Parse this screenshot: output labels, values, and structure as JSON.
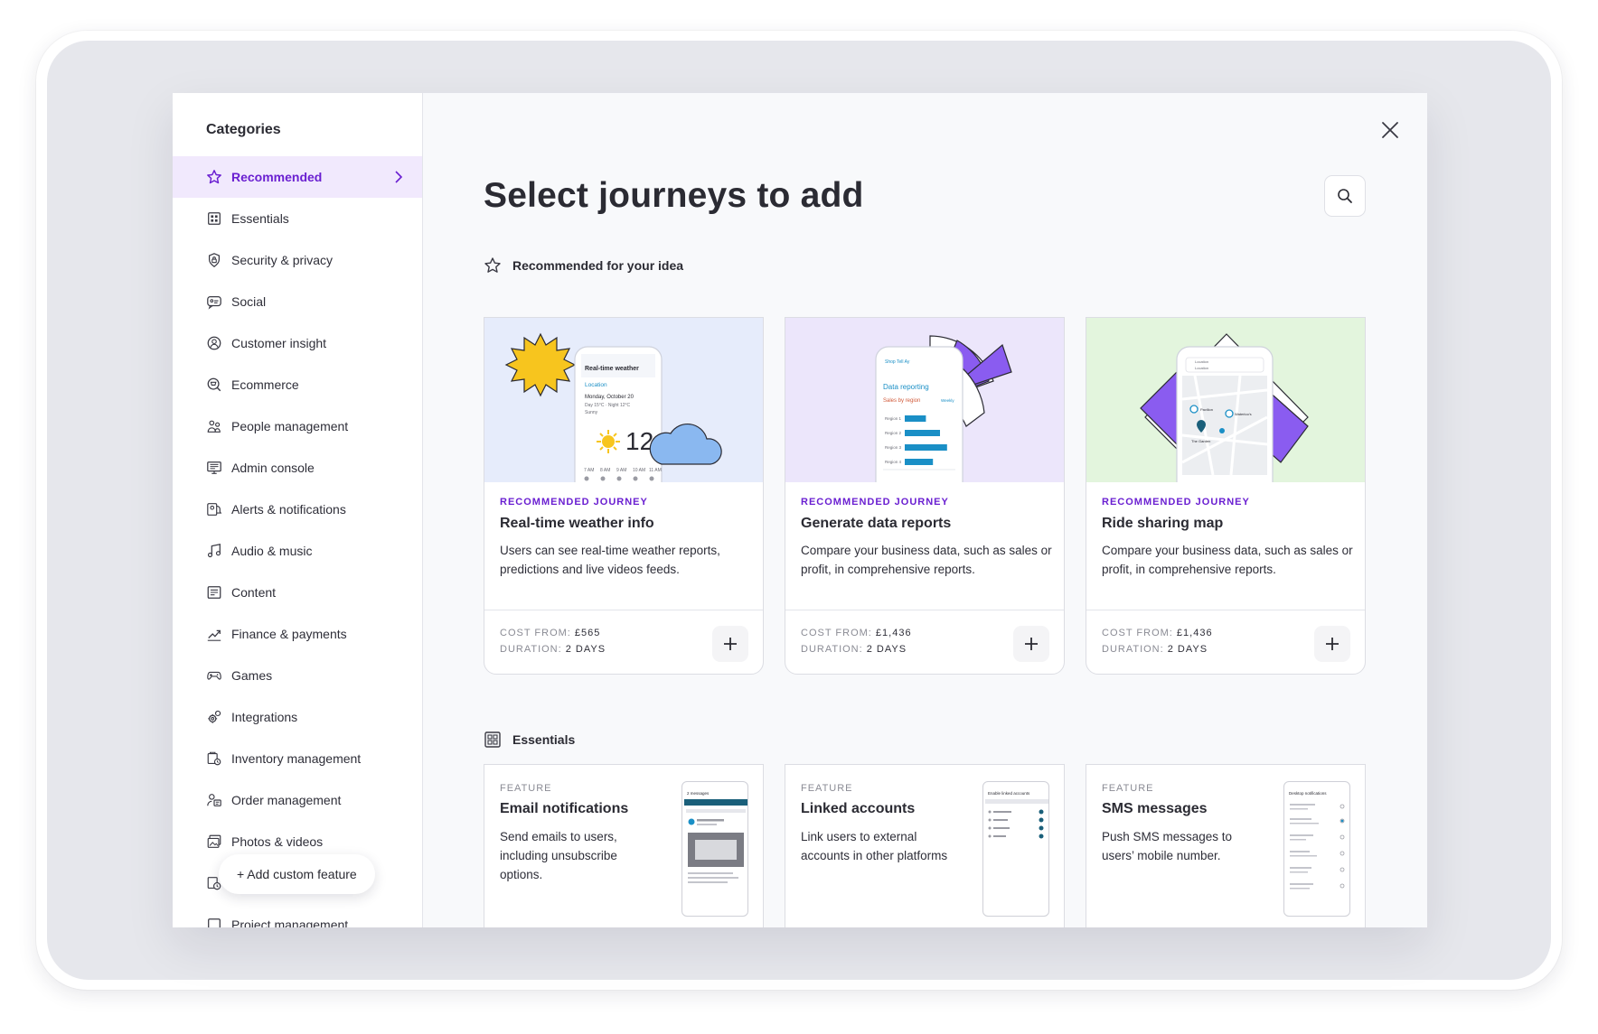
{
  "sidebar": {
    "title": "Categories",
    "items": [
      {
        "label": "Recommended",
        "icon": "star-icon"
      },
      {
        "label": "Essentials",
        "icon": "grid-icon"
      },
      {
        "label": "Security & privacy",
        "icon": "shield-icon"
      },
      {
        "label": "Social",
        "icon": "chat-icon"
      },
      {
        "label": "Customer insight",
        "icon": "insight-icon"
      },
      {
        "label": "Ecommerce",
        "icon": "cart-icon"
      },
      {
        "label": "People management",
        "icon": "people-icon"
      },
      {
        "label": "Admin console",
        "icon": "console-icon"
      },
      {
        "label": "Alerts & notifications",
        "icon": "bell-icon"
      },
      {
        "label": "Audio & music",
        "icon": "music-icon"
      },
      {
        "label": "Content",
        "icon": "content-icon"
      },
      {
        "label": "Finance & payments",
        "icon": "finance-icon"
      },
      {
        "label": "Games",
        "icon": "gamepad-icon"
      },
      {
        "label": "Integrations",
        "icon": "cog-icon"
      },
      {
        "label": "Inventory management",
        "icon": "inventory-icon"
      },
      {
        "label": "Order management",
        "icon": "order-icon"
      },
      {
        "label": "Photos & videos",
        "icon": "photo-icon"
      },
      {
        "label": "",
        "icon": "clock-icon"
      },
      {
        "label": "Project management",
        "icon": "project-icon"
      }
    ],
    "add_custom": "+ Add custom feature"
  },
  "main": {
    "title": "Select journeys to add",
    "recommended": {
      "heading": "Recommended for your idea",
      "cards": [
        {
          "tag": "RECOMMENDED JOURNEY",
          "title": "Real-time weather info",
          "desc": "Users can see real-time weather reports, predictions and live videos feeds.",
          "cost_label": "COST FROM:",
          "cost": "£565",
          "duration_label": "DURATION:",
          "duration": "2 DAYS",
          "bg": "#e6ecfb",
          "phone": {
            "title": "Real-time weather",
            "location": "Location",
            "date": "Monday, October 20",
            "range": "Day 15°C · Night 12°C",
            "cond": "Sunny",
            "temp": "12",
            "times": [
              "7 AM",
              "8 AM",
              "9 AM",
              "10 AM",
              "11 AM"
            ]
          }
        },
        {
          "tag": "RECOMMENDED JOURNEY",
          "title": "Generate data reports",
          "desc": "Compare your business data, such as sales or profit, in comprehensive reports.",
          "cost_label": "COST FROM:",
          "cost": "£1,436",
          "duration_label": "DURATION:",
          "duration": "2 DAYS",
          "bg": "#ece6fb",
          "phone": {
            "app": "Shop Tell Ay",
            "title": "Data reporting",
            "subtitle": "Sales by region",
            "filter": "Weekly",
            "regions": [
              "Region 1",
              "Region 2",
              "Region 3",
              "Region 4"
            ],
            "bars": [
              0.45,
              0.75,
              0.9,
              0.6
            ]
          }
        },
        {
          "tag": "RECOMMENDED JOURNEY",
          "title": "Ride sharing map",
          "desc": "Compare your business data, such as sales or profit, in comprehensive reports.",
          "cost_label": "COST FROM:",
          "cost": "£1,436",
          "duration_label": "DURATION:",
          "duration": "2 DAYS",
          "bg": "#e3f5dd",
          "phone": {
            "field1": "Location",
            "field2": "Location",
            "place1": "Pavilion",
            "place2": "Waterloo's",
            "place3": "The Garden"
          }
        }
      ]
    },
    "essentials": {
      "heading": "Essentials",
      "cards": [
        {
          "tag": "FEATURE",
          "title": "Email notifications",
          "desc": "Send emails to users, including unsubscribe options.",
          "thumb_title": "2 messages"
        },
        {
          "tag": "FEATURE",
          "title": "Linked accounts",
          "desc": "Link users to external accounts in other platforms",
          "thumb_title": "Enable linked accounts"
        },
        {
          "tag": "FEATURE",
          "title": "SMS messages",
          "desc": "Push SMS messages to users’ mobile number.",
          "thumb_title": "Desktop notifications"
        }
      ]
    }
  },
  "colors": {
    "accent": "#6a1fd1",
    "active_bg": "#f1e9fd",
    "cloud": "#8ab8f0",
    "sun": "#f7c51e",
    "purple_shape": "#8a5cf0",
    "teal_bar": "#1a8fc6"
  }
}
